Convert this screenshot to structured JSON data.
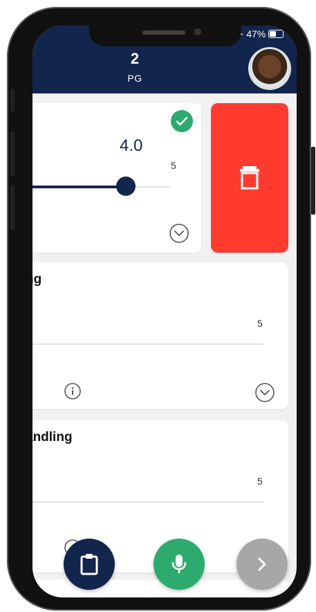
{
  "status": {
    "left": "..",
    "battery_text": "47%"
  },
  "header": {
    "player_number": "2",
    "position": "PG",
    "avatar": "player-avatar"
  },
  "rating_cards": [
    {
      "title": "",
      "value": "4.0",
      "max_label": "5",
      "completed": true,
      "slider_fraction": 0.8
    },
    {
      "title": "ng",
      "max_label": "5"
    },
    {
      "title": "andling",
      "max_label": "5"
    }
  ],
  "delete_action": {
    "icon": "trash-icon",
    "color": "#ff3b30"
  },
  "fabs": [
    {
      "icon": "clipboard-icon",
      "color": "#12254d"
    },
    {
      "icon": "microphone-icon",
      "color": "#2dab6e"
    },
    {
      "icon": "chevron-right-icon",
      "color": "#a7a7a7"
    }
  ],
  "colors": {
    "primary": "#12254d",
    "success": "#2dab6e",
    "danger": "#ff3b30"
  }
}
